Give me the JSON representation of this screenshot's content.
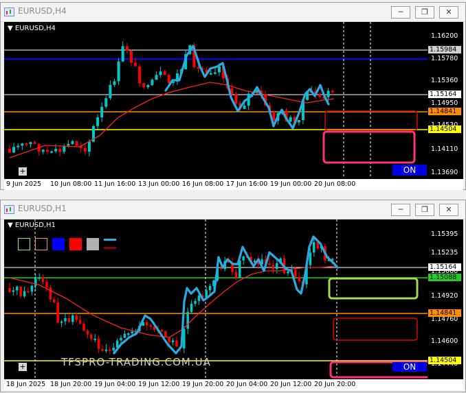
{
  "window1": {
    "title": "EURUSD,H4",
    "symbol_label": "EURUSD,H4",
    "buttons": [
      "minimize",
      "restore",
      "close"
    ],
    "price_ticks": [
      "1.16200",
      "1.15780",
      "1.15360",
      "1.14950",
      "1.14530",
      "1.14110",
      "1.13690"
    ],
    "price_tags": [
      {
        "text": "1.15984",
        "bg": "#d0d0d0",
        "fg": "#000000"
      },
      {
        "text": "1.15164",
        "bg": "#ffffff",
        "fg": "#000000"
      },
      {
        "text": "1.14841",
        "bg": "#ff8c00",
        "fg": "#000000"
      },
      {
        "text": "1.14504",
        "bg": "#ffff00",
        "fg": "#000000"
      }
    ],
    "time_labels": [
      "9 Jun 2025",
      "10 Jun 08:00",
      "11 Jun 16:00",
      "13 Jun 00:00",
      "16 Jun 08:00",
      "17 Jun 16:00",
      "19 Jun 00:00",
      "20 Jun 08:00"
    ],
    "on_button": "ON",
    "plus_button": "+"
  },
  "window2": {
    "title": "EURUSD,H1",
    "symbol_label": "EURUSD,H1",
    "buttons": [
      "minimize",
      "restore",
      "close"
    ],
    "price_ticks": [
      "1.15395",
      "1.15235",
      "1.15080",
      "1.14920",
      "1.14760",
      "1.14600",
      "1.14440"
    ],
    "price_tags": [
      {
        "text": "1.15164",
        "bg": "#ffffff",
        "fg": "#000000"
      },
      {
        "text": "1.15088",
        "bg": "#22cc22",
        "fg": "#000000"
      },
      {
        "text": "1.14841",
        "bg": "#ff8c00",
        "fg": "#000000"
      },
      {
        "text": "1.14504",
        "bg": "#ffff00",
        "fg": "#000000"
      }
    ],
    "time_labels": [
      "18 Jun 2025",
      "18 Jun 20:00",
      "19 Jun 04:00",
      "19 Jun 12:00",
      "19 Jun 20:00",
      "20 Jun 04:00",
      "20 Jun 12:00",
      "20 Jun 20:00"
    ],
    "watermark": "TFSPRO-TRADING.COM.UA",
    "on_button": "ON",
    "plus_button": "+",
    "color_swatches": [
      {
        "color": "#90ee90",
        "style": "outline"
      },
      {
        "color": "#ff8c60",
        "style": "outline"
      },
      {
        "color": "#0000ff",
        "style": "fill"
      },
      {
        "color": "#ff0000",
        "style": "fill"
      },
      {
        "color": "#b0b0b0",
        "style": "fill"
      }
    ]
  },
  "colors": {
    "bull": "#00c8c8",
    "bear": "#ff0000",
    "ma": "#ff2020",
    "wave": "#29abe2",
    "blue_level": "#0000ff",
    "orange_level": "#ff8c00",
    "yellow_level": "#ffff00",
    "green_level": "#22cc22",
    "pink_box": "#ff3377"
  }
}
